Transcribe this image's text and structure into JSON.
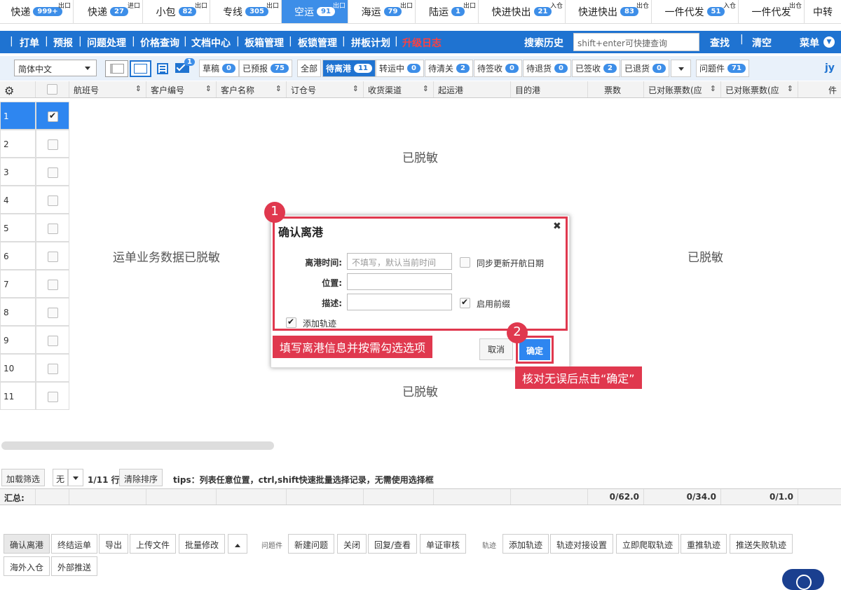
{
  "top_tabs": [
    {
      "label": "快递",
      "badge": "999+",
      "sup": "出口",
      "active": false
    },
    {
      "label": "快递",
      "badge": "27",
      "sup": "进口",
      "active": false
    },
    {
      "label": "小包",
      "badge": "82",
      "sup": "出口",
      "active": false
    },
    {
      "label": "专线",
      "badge": "305",
      "sup": "出口",
      "active": false
    },
    {
      "label": "空运",
      "badge": "91",
      "sup": "出口",
      "active": true
    },
    {
      "label": "海运",
      "badge": "79",
      "sup": "出口",
      "active": false
    },
    {
      "label": "陆运",
      "badge": "1",
      "sup": "出口",
      "active": false
    },
    {
      "label": "快进快出",
      "badge": "21",
      "sup": "入仓",
      "active": false
    },
    {
      "label": "快进快出",
      "badge": "83",
      "sup": "出仓",
      "active": false
    },
    {
      "label": "一件代发",
      "badge": "51",
      "sup": "入仓",
      "active": false
    },
    {
      "label": "一件代发",
      "badge": "",
      "sup": "出仓",
      "active": false
    },
    {
      "label": "中转",
      "badge": "",
      "sup": "",
      "active": false
    }
  ],
  "menu": {
    "items": [
      "打单",
      "预报",
      "问题处理",
      "价格查询",
      "文档中心",
      "板箱管理",
      "板锁管理",
      "拼板计划",
      "升级日志"
    ],
    "search_history": "搜索历史",
    "search_placeholder": "shift+enter可快捷查询",
    "find": "查找",
    "clear": "清空",
    "menu_label": "菜单",
    "highlight_color": "#ff4040"
  },
  "toolbar": {
    "language": "简体中文",
    "mail_badge": "1",
    "filters": [
      {
        "label": "草稿",
        "badge": "0"
      },
      {
        "label": "已预报",
        "badge": "75"
      },
      {
        "label": "全部",
        "badge": ""
      },
      {
        "label": "待离港",
        "badge": "11",
        "active": true
      },
      {
        "label": "转运中",
        "badge": "0"
      },
      {
        "label": "待清关",
        "badge": "2"
      },
      {
        "label": "待签收",
        "badge": "0"
      },
      {
        "label": "待退货",
        "badge": "0"
      },
      {
        "label": "已签收",
        "badge": "2"
      },
      {
        "label": "已退货",
        "badge": "0"
      }
    ],
    "problem": {
      "label": "问题件",
      "badge": "71"
    },
    "user": "jy"
  },
  "table": {
    "columns": [
      "航班号",
      "客户编号",
      "客户名称",
      "订仓号",
      "收货渠道",
      "起运港",
      "目的港",
      "票数",
      "已对账票数(应",
      "已对账票数(应",
      "件"
    ],
    "row_numbers": [
      "1",
      "2",
      "3",
      "4",
      "5",
      "6",
      "7",
      "8",
      "9",
      "10",
      "11"
    ],
    "masked_texts": [
      "已脱敏",
      "运单业务数据已脱敏",
      "已脱敏",
      "已脱敏"
    ]
  },
  "dialog": {
    "title": "确认离港",
    "close": "✖",
    "depart_time_label": "离港时间:",
    "depart_time_placeholder": "不填写，默认当前时间",
    "sync_label": "同步更新开航日期",
    "location_label": "位置:",
    "desc_label": "描述:",
    "prefix_label": "启用前缀",
    "add_track_label": "添加轨迹",
    "cancel": "取消",
    "ok": "确定"
  },
  "annotations": {
    "step1": "1",
    "step2": "2",
    "tip1": "填写离港信息并按需勾选选项",
    "tip2": "核对无误后点击“确定”",
    "accent": "#e0384e"
  },
  "pager": {
    "load_filter": "加载筛选",
    "select_value": "无",
    "page": "1/11 行",
    "clear_sort": "清除排序",
    "tips": "tips：列表任意位置，ctrl,shift快速批量选择记录，无需使用选择框"
  },
  "summary": {
    "label": "汇总:",
    "values": [
      "0/62.0",
      "0/34.0",
      "0/1.0"
    ]
  },
  "actions": {
    "main": [
      "确认离港",
      "终结运单",
      "导出",
      "上传文件",
      "批量修改"
    ],
    "problem_group": "问题件",
    "problem": [
      "新建问题",
      "关闭",
      "回复/查看",
      "单证审核"
    ],
    "track_group": "轨迹",
    "track": [
      "添加轨迹",
      "轨迹对接设置",
      "立即爬取轨迹",
      "重推轨迹",
      "推送失败轨迹"
    ],
    "row2": [
      "海外入仓",
      "外部推送"
    ]
  }
}
